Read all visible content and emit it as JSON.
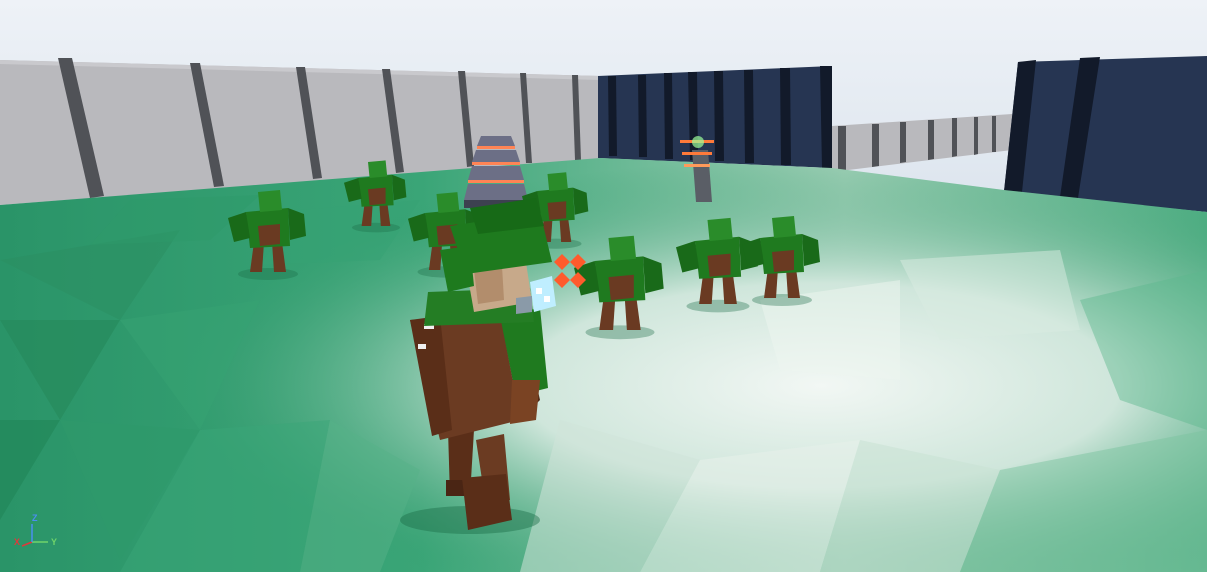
{
  "viewport": {
    "axis_gizmo": {
      "x_label": "X",
      "y_label": "Y",
      "z_label": "Z",
      "colors": {
        "x": "#e0383b",
        "y": "#6fd36a",
        "z": "#4a8ff0"
      }
    }
  },
  "scene": {
    "colors": {
      "sky": "#e6ebf2",
      "ground_green": "#2f9a6a",
      "ground_light": "#dfeae6",
      "wall_gray": "#b8b8bc",
      "wall_navy": "#253450",
      "enemy_green": "#1f7a1f",
      "enemy_brown": "#6a3a22",
      "player_brown": "#6b3b22",
      "hit_marker": "#ff5b2c"
    },
    "enemy_count": 7
  }
}
